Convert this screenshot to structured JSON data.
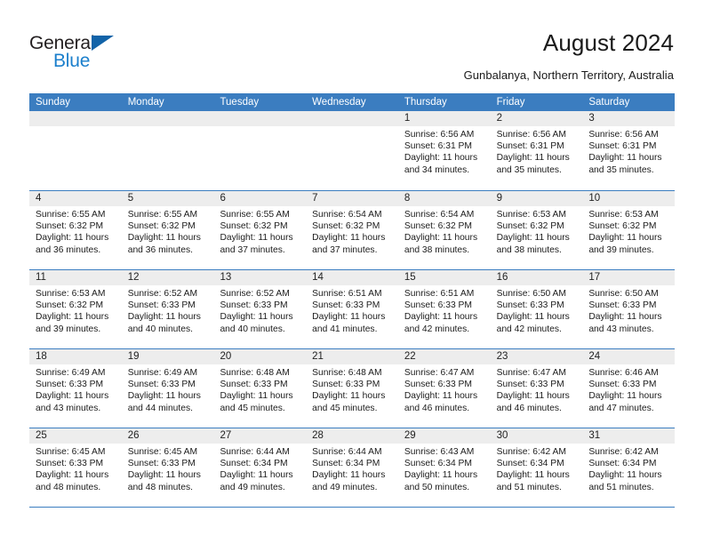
{
  "header": {
    "logo": {
      "text_primary": "General",
      "text_secondary": "Blue",
      "triangle_icon": "triangle-icon",
      "color_primary": "#231f20",
      "color_secondary": "#1b7fcc",
      "color_triangle": "#1263a8"
    },
    "title": "August 2024",
    "subtitle": "Gunbalanya, Northern Territory, Australia"
  },
  "calendar": {
    "accent_color": "#3b7dc0",
    "day_band_color": "#ededed",
    "weekdays": [
      "Sunday",
      "Monday",
      "Tuesday",
      "Wednesday",
      "Thursday",
      "Friday",
      "Saturday"
    ],
    "weeks": [
      [
        {
          "day": "",
          "lines": []
        },
        {
          "day": "",
          "lines": []
        },
        {
          "day": "",
          "lines": []
        },
        {
          "day": "",
          "lines": []
        },
        {
          "day": "1",
          "lines": [
            "Sunrise: 6:56 AM",
            "Sunset: 6:31 PM",
            "Daylight: 11 hours",
            "and 34 minutes."
          ]
        },
        {
          "day": "2",
          "lines": [
            "Sunrise: 6:56 AM",
            "Sunset: 6:31 PM",
            "Daylight: 11 hours",
            "and 35 minutes."
          ]
        },
        {
          "day": "3",
          "lines": [
            "Sunrise: 6:56 AM",
            "Sunset: 6:31 PM",
            "Daylight: 11 hours",
            "and 35 minutes."
          ]
        }
      ],
      [
        {
          "day": "4",
          "lines": [
            "Sunrise: 6:55 AM",
            "Sunset: 6:32 PM",
            "Daylight: 11 hours",
            "and 36 minutes."
          ]
        },
        {
          "day": "5",
          "lines": [
            "Sunrise: 6:55 AM",
            "Sunset: 6:32 PM",
            "Daylight: 11 hours",
            "and 36 minutes."
          ]
        },
        {
          "day": "6",
          "lines": [
            "Sunrise: 6:55 AM",
            "Sunset: 6:32 PM",
            "Daylight: 11 hours",
            "and 37 minutes."
          ]
        },
        {
          "day": "7",
          "lines": [
            "Sunrise: 6:54 AM",
            "Sunset: 6:32 PM",
            "Daylight: 11 hours",
            "and 37 minutes."
          ]
        },
        {
          "day": "8",
          "lines": [
            "Sunrise: 6:54 AM",
            "Sunset: 6:32 PM",
            "Daylight: 11 hours",
            "and 38 minutes."
          ]
        },
        {
          "day": "9",
          "lines": [
            "Sunrise: 6:53 AM",
            "Sunset: 6:32 PM",
            "Daylight: 11 hours",
            "and 38 minutes."
          ]
        },
        {
          "day": "10",
          "lines": [
            "Sunrise: 6:53 AM",
            "Sunset: 6:32 PM",
            "Daylight: 11 hours",
            "and 39 minutes."
          ]
        }
      ],
      [
        {
          "day": "11",
          "lines": [
            "Sunrise: 6:53 AM",
            "Sunset: 6:32 PM",
            "Daylight: 11 hours",
            "and 39 minutes."
          ]
        },
        {
          "day": "12",
          "lines": [
            "Sunrise: 6:52 AM",
            "Sunset: 6:33 PM",
            "Daylight: 11 hours",
            "and 40 minutes."
          ]
        },
        {
          "day": "13",
          "lines": [
            "Sunrise: 6:52 AM",
            "Sunset: 6:33 PM",
            "Daylight: 11 hours",
            "and 40 minutes."
          ]
        },
        {
          "day": "14",
          "lines": [
            "Sunrise: 6:51 AM",
            "Sunset: 6:33 PM",
            "Daylight: 11 hours",
            "and 41 minutes."
          ]
        },
        {
          "day": "15",
          "lines": [
            "Sunrise: 6:51 AM",
            "Sunset: 6:33 PM",
            "Daylight: 11 hours",
            "and 42 minutes."
          ]
        },
        {
          "day": "16",
          "lines": [
            "Sunrise: 6:50 AM",
            "Sunset: 6:33 PM",
            "Daylight: 11 hours",
            "and 42 minutes."
          ]
        },
        {
          "day": "17",
          "lines": [
            "Sunrise: 6:50 AM",
            "Sunset: 6:33 PM",
            "Daylight: 11 hours",
            "and 43 minutes."
          ]
        }
      ],
      [
        {
          "day": "18",
          "lines": [
            "Sunrise: 6:49 AM",
            "Sunset: 6:33 PM",
            "Daylight: 11 hours",
            "and 43 minutes."
          ]
        },
        {
          "day": "19",
          "lines": [
            "Sunrise: 6:49 AM",
            "Sunset: 6:33 PM",
            "Daylight: 11 hours",
            "and 44 minutes."
          ]
        },
        {
          "day": "20",
          "lines": [
            "Sunrise: 6:48 AM",
            "Sunset: 6:33 PM",
            "Daylight: 11 hours",
            "and 45 minutes."
          ]
        },
        {
          "day": "21",
          "lines": [
            "Sunrise: 6:48 AM",
            "Sunset: 6:33 PM",
            "Daylight: 11 hours",
            "and 45 minutes."
          ]
        },
        {
          "day": "22",
          "lines": [
            "Sunrise: 6:47 AM",
            "Sunset: 6:33 PM",
            "Daylight: 11 hours",
            "and 46 minutes."
          ]
        },
        {
          "day": "23",
          "lines": [
            "Sunrise: 6:47 AM",
            "Sunset: 6:33 PM",
            "Daylight: 11 hours",
            "and 46 minutes."
          ]
        },
        {
          "day": "24",
          "lines": [
            "Sunrise: 6:46 AM",
            "Sunset: 6:33 PM",
            "Daylight: 11 hours",
            "and 47 minutes."
          ]
        }
      ],
      [
        {
          "day": "25",
          "lines": [
            "Sunrise: 6:45 AM",
            "Sunset: 6:33 PM",
            "Daylight: 11 hours",
            "and 48 minutes."
          ]
        },
        {
          "day": "26",
          "lines": [
            "Sunrise: 6:45 AM",
            "Sunset: 6:33 PM",
            "Daylight: 11 hours",
            "and 48 minutes."
          ]
        },
        {
          "day": "27",
          "lines": [
            "Sunrise: 6:44 AM",
            "Sunset: 6:34 PM",
            "Daylight: 11 hours",
            "and 49 minutes."
          ]
        },
        {
          "day": "28",
          "lines": [
            "Sunrise: 6:44 AM",
            "Sunset: 6:34 PM",
            "Daylight: 11 hours",
            "and 49 minutes."
          ]
        },
        {
          "day": "29",
          "lines": [
            "Sunrise: 6:43 AM",
            "Sunset: 6:34 PM",
            "Daylight: 11 hours",
            "and 50 minutes."
          ]
        },
        {
          "day": "30",
          "lines": [
            "Sunrise: 6:42 AM",
            "Sunset: 6:34 PM",
            "Daylight: 11 hours",
            "and 51 minutes."
          ]
        },
        {
          "day": "31",
          "lines": [
            "Sunrise: 6:42 AM",
            "Sunset: 6:34 PM",
            "Daylight: 11 hours",
            "and 51 minutes."
          ]
        }
      ]
    ]
  }
}
